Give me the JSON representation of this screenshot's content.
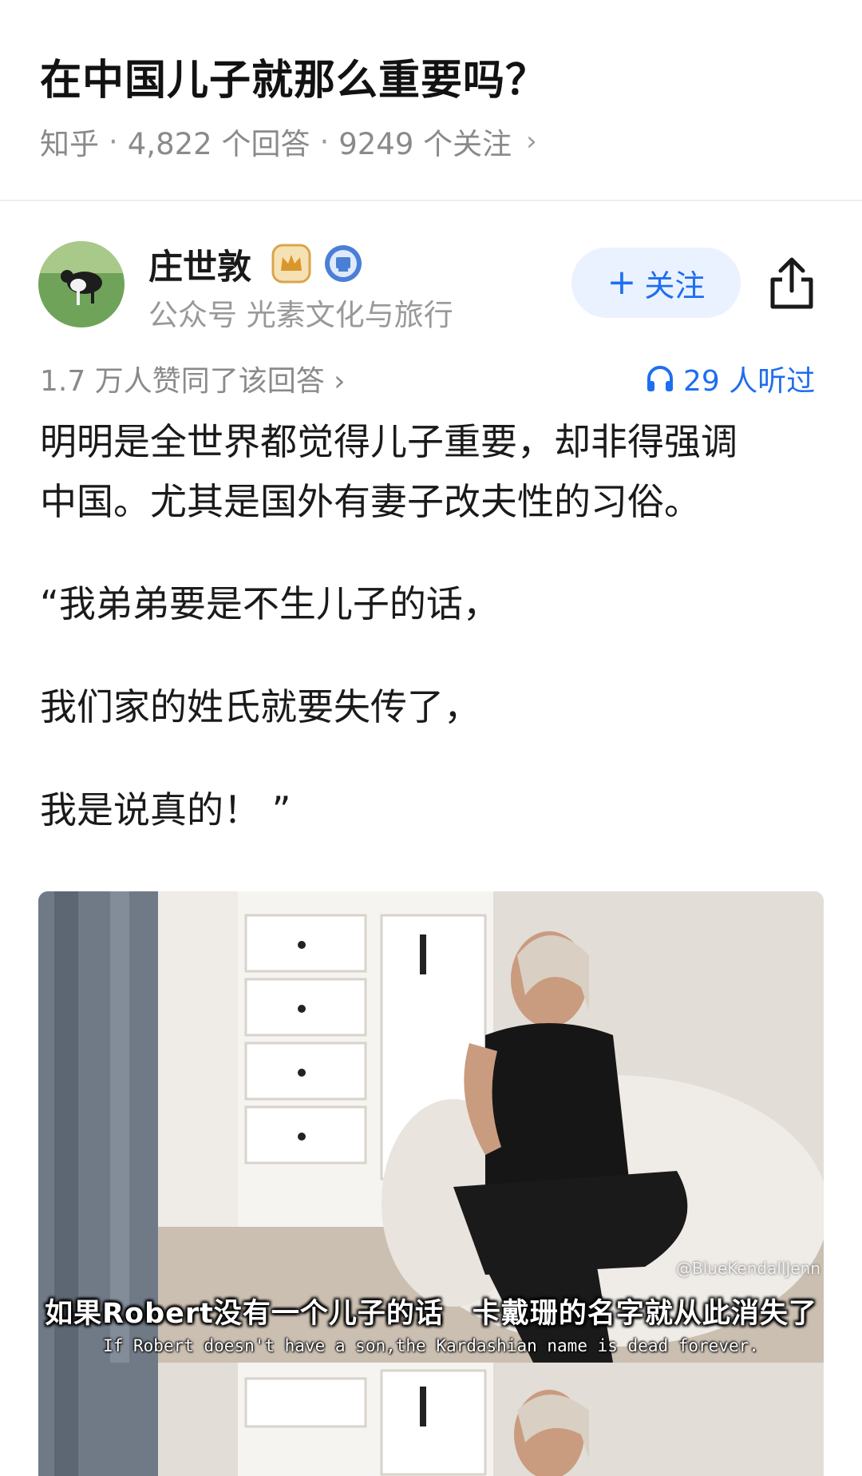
{
  "question": {
    "title": "在中国儿子就那么重要吗？",
    "source": "知乎",
    "separator": "·",
    "answers_count": "4,822 个回答",
    "followers_count": "9249 个关注",
    "chevron": "›"
  },
  "author": {
    "name": "庄世敦",
    "subtitle": "公众号 光素文化与旅行",
    "badges": [
      "crown-badge-icon",
      "blue-verified-badge-icon"
    ],
    "follow_plus": "+",
    "follow_label": "关注",
    "share_icon": "share-icon"
  },
  "stats": {
    "agree_text": "1.7 万人赞同了该回答 ›",
    "listen_text": "29 人听过",
    "listen_icon": "headphones-icon"
  },
  "content": {
    "paragraph_1_line_1": "明明是全世界都觉得儿子重要，却非得强调",
    "paragraph_1_line_2": "中国。尤其是国外有妻子改夫性的习俗。",
    "quote_line_1": "“我弟弟要是不生儿子的话，",
    "quote_line_2": "我们家的姓氏就要失传了，",
    "quote_line_3": "我是说真的！ ”"
  },
  "image": {
    "subtitle_cn": "如果Robert没有一个儿子的话　卡戴珊的名字就从此消失了",
    "subtitle_en": "If Robert doesn't have a son,the Kardashian name is dead forever.",
    "watermark": "@BlueKendallJenn"
  },
  "colors": {
    "accent_blue": "#1e6ef0",
    "follow_bg": "#eaf2ff",
    "muted_text": "#8a8a8a",
    "body_text": "#1a1a1a"
  }
}
